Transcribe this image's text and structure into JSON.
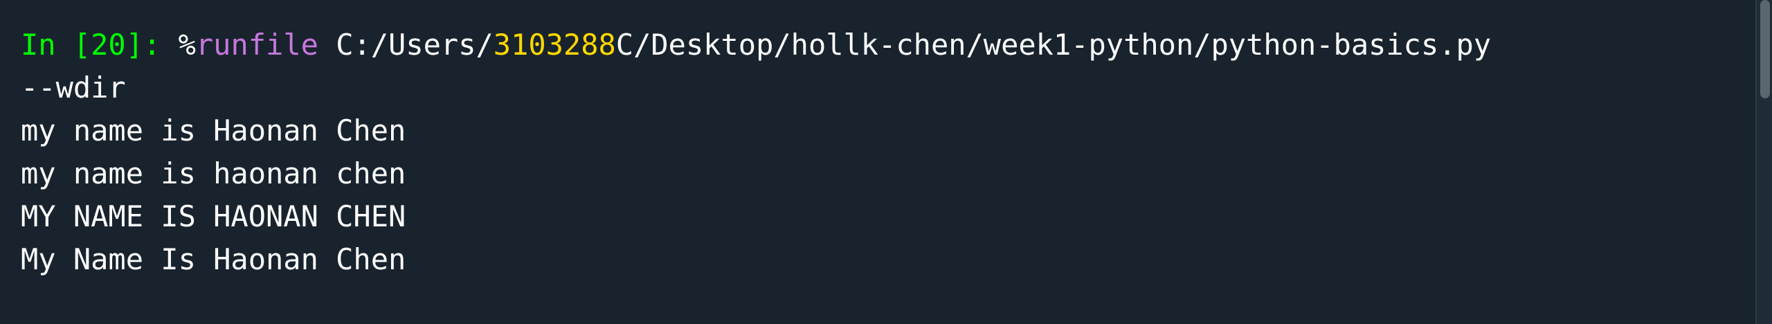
{
  "console": {
    "input_prompt": "In [20]:",
    "command": {
      "magic_percent": "%",
      "magic_name": "runfile",
      "path_prefix": "C:/Users/",
      "path_number": "3103288",
      "path_suffix": "C/Desktop/hollk-chen/week1-python/python-basics.py",
      "continuation": "--wdir"
    },
    "output_lines": [
      "my name is Haonan Chen",
      "my name is haonan chen",
      "MY NAME IS HAONAN CHEN",
      "My Name Is Haonan Chen"
    ]
  },
  "colors": {
    "background": "#19232d",
    "prompt": "#00ff00",
    "magic": "#c678dd",
    "number": "#ffd700",
    "text": "#ffffff"
  }
}
